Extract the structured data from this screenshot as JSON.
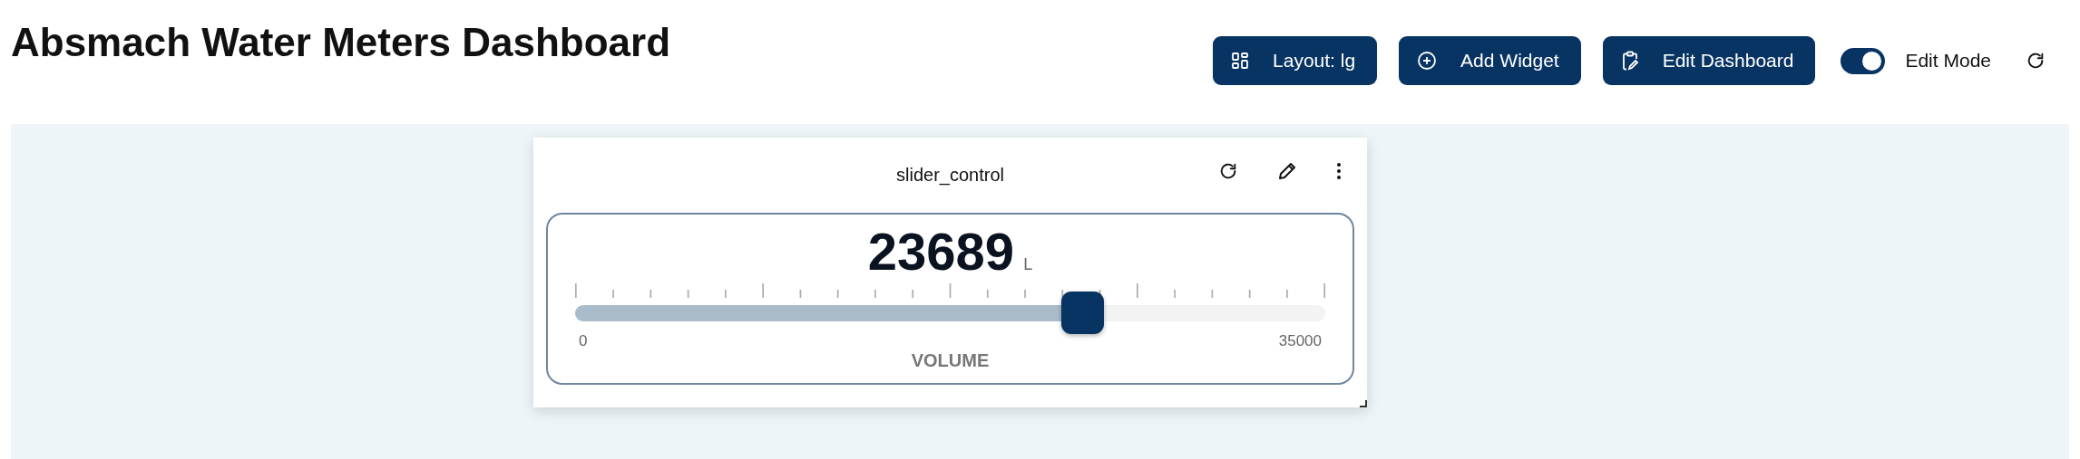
{
  "title": "Absmach Water Meters Dashboard",
  "toolbar": {
    "buttons": [
      {
        "kind": "layout",
        "label": "Layout: lg"
      },
      {
        "kind": "add",
        "label": "Add Widget"
      },
      {
        "kind": "edit",
        "label": "Edit Dashboard"
      }
    ],
    "edit_mode": {
      "label": "Edit Mode",
      "on": true
    }
  },
  "widget": {
    "title": "slider_control",
    "value": "23689",
    "unit": "L",
    "level": 0.677,
    "min": "0",
    "max": "35000",
    "label": "VOLUME"
  }
}
